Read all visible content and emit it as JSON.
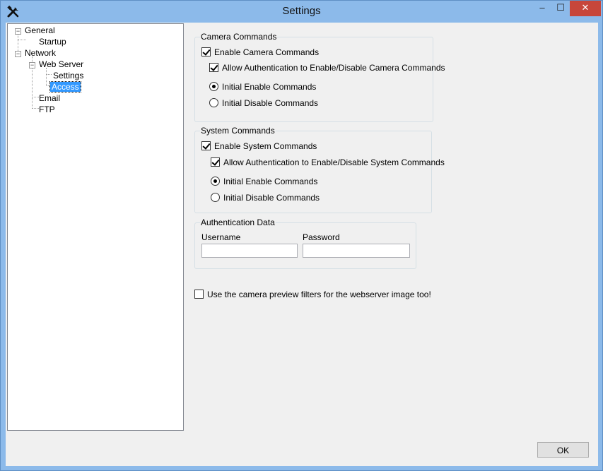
{
  "window": {
    "title": "Settings",
    "controls": {
      "minimize": "–",
      "maximize": "☐",
      "close": "✕"
    }
  },
  "tree": {
    "nodes": [
      {
        "label": "General",
        "expanded": true
      },
      {
        "label": "Startup"
      },
      {
        "label": "Network",
        "expanded": true
      },
      {
        "label": "Web Server",
        "expanded": true
      },
      {
        "label": "Settings"
      },
      {
        "label": "Access",
        "selected": true
      },
      {
        "label": "Email"
      },
      {
        "label": "FTP"
      }
    ],
    "expander_symbol": "−"
  },
  "camera_commands": {
    "title": "Camera Commands",
    "enable": {
      "label": "Enable Camera Commands",
      "checked": true
    },
    "allow_auth": {
      "label": "Allow Authentication to Enable/Disable Camera Commands",
      "checked": true
    },
    "initial_enable": {
      "label": "Initial Enable Commands",
      "selected": true
    },
    "initial_disable": {
      "label": "Initial Disable Commands",
      "selected": false
    }
  },
  "system_commands": {
    "title": "System Commands",
    "enable": {
      "label": "Enable System Commands",
      "checked": true
    },
    "allow_auth": {
      "label": "Allow Authentication to Enable/Disable System Commands",
      "checked": true
    },
    "initial_enable": {
      "label": "Initial Enable Commands",
      "selected": true
    },
    "initial_disable": {
      "label": "Initial Disable Commands",
      "selected": false
    }
  },
  "authentication": {
    "title": "Authentication Data",
    "username_label": "Username",
    "username_value": "",
    "password_label": "Password",
    "password_value": ""
  },
  "preview_filters": {
    "label": "Use the camera preview filters for the webserver image too!",
    "checked": false
  },
  "ok_label": "OK",
  "colors": {
    "accent": "#3399ff",
    "title_bar": "#8cbaea",
    "close_button": "#c7463a"
  },
  "icons": {
    "app": "tools-icon"
  }
}
